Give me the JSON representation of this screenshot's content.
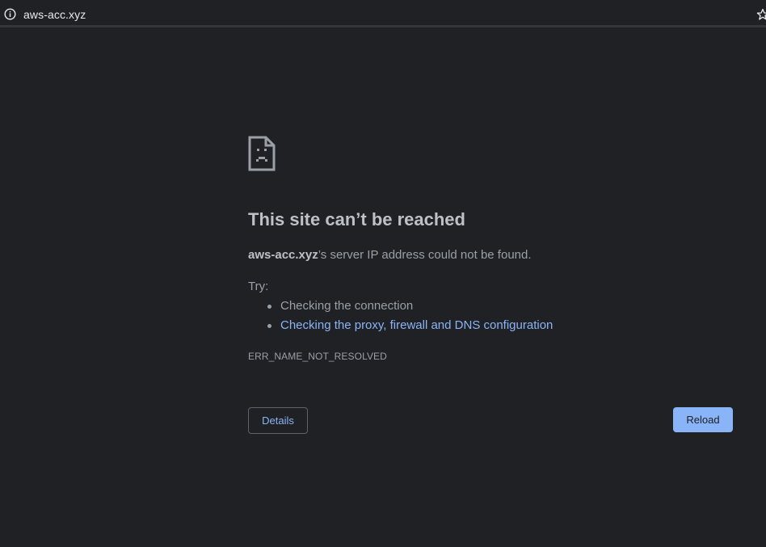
{
  "omnibox": {
    "info_icon": "info-circle-icon",
    "url": "aws-acc.xyz",
    "star_icon": "star-outline-icon"
  },
  "error_page": {
    "icon": "sad-page-icon",
    "heading": "This site can’t be reached",
    "summary_host": "aws-acc.xyz",
    "summary_rest": "’s server IP address could not be found.",
    "try_label": "Try:",
    "suggestions": [
      "Checking the connection",
      "Checking the proxy, firewall and DNS configuration"
    ],
    "error_code": "ERR_NAME_NOT_RESOLVED",
    "details_label": "Details",
    "reload_label": "Reload"
  },
  "colors": {
    "background": "#202124",
    "link": "#8ab4f8",
    "button_primary": "#8ab4f8"
  }
}
